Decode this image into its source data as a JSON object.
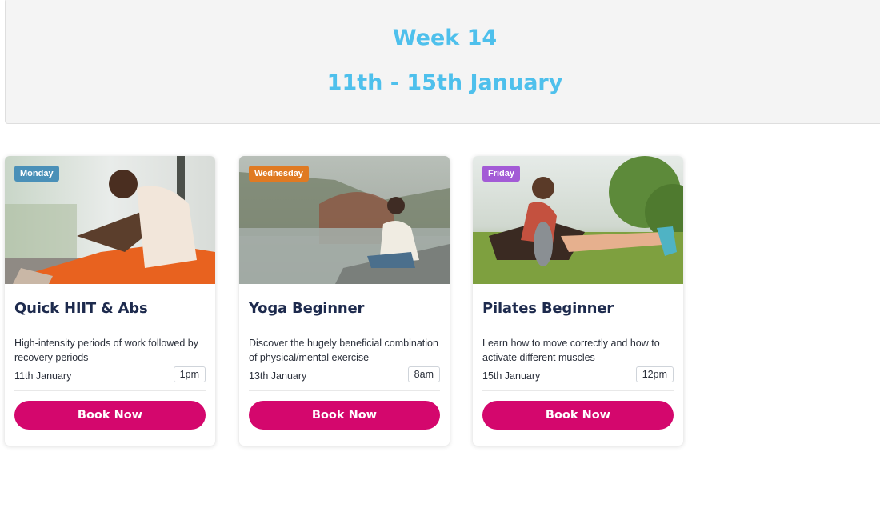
{
  "header": {
    "title": "Week 14",
    "dates": "11th - 15th January"
  },
  "colors": {
    "header_text": "#4ec0ec",
    "button": "#d4076d",
    "badge_monday": "#4a90b8",
    "badge_wednesday": "#e07a22",
    "badge_friday": "#a35bd6"
  },
  "cards": [
    {
      "day": "Monday",
      "title": "Quick HIIT & Abs",
      "description": "High-intensity periods of work followed by recovery periods",
      "date": "11th January",
      "time": "1pm",
      "button": "Book Now",
      "image": "woman-stretching-indoors-photo"
    },
    {
      "day": "Wednesday",
      "title": "Yoga Beginner",
      "description": "Discover the hugely beneficial combination of physical/mental exercise",
      "date": "13th January",
      "time": "8am",
      "button": "Book Now",
      "image": "woman-meditating-by-lake-photo"
    },
    {
      "day": "Friday",
      "title": "Pilates Beginner",
      "description": "Learn how to move correctly and how to activate different muscles",
      "date": "15th January",
      "time": "12pm",
      "button": "Book Now",
      "image": "woman-stretching-on-grass-photo"
    }
  ]
}
